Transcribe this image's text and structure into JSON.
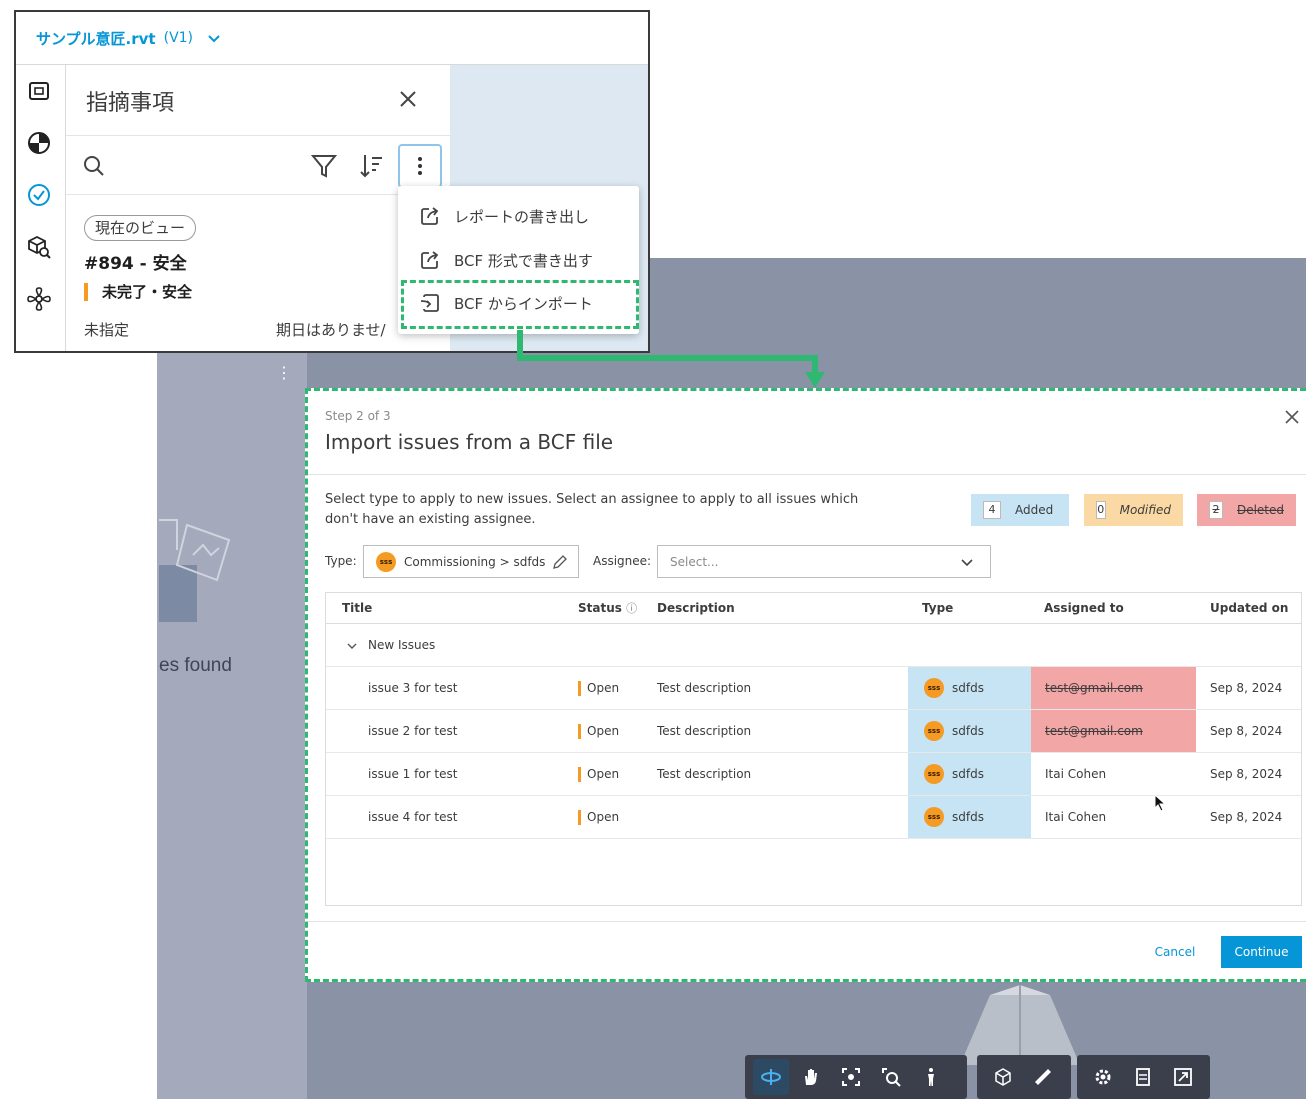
{
  "revit_panel": {
    "file_name": "サンプル意匠.rvt",
    "version": "(V1)",
    "issues_title": "指摘事項",
    "issue": {
      "chip": "現在のビュー",
      "id_title": "#894 - 安全",
      "status": "未完了・安全",
      "assignee": "未指定",
      "due": "期日はありませ/"
    },
    "menu": [
      {
        "label": "レポートの書き出し",
        "icon": "export-icon"
      },
      {
        "label": "BCF 形式で書き出す",
        "icon": "export-icon"
      },
      {
        "label": "BCF からインポート",
        "icon": "import-icon"
      }
    ]
  },
  "background": {
    "empty_text": "es found"
  },
  "dialog": {
    "step": "Step 2 of 3",
    "title": "Import issues from a BCF file",
    "instructions": "Select type to apply to new issues. Select an assignee to apply to all issues which don't have an existing assignee.",
    "legend": [
      {
        "count": "4",
        "label": "Added",
        "color": "#c6e4f4"
      },
      {
        "count": "0",
        "label": "Modified",
        "color": "#fbd9a4"
      },
      {
        "count": "2",
        "label": "Deleted",
        "color": "#f2a6a6"
      }
    ],
    "type_label": "Type:",
    "type_value": "Commissioning > sdfds",
    "badge": "sss",
    "assignee_label": "Assignee:",
    "assignee_placeholder": "Select...",
    "columns": [
      "Title",
      "Status",
      "Description",
      "Type",
      "Assigned to",
      "Updated on"
    ],
    "group": "New Issues",
    "rows": [
      {
        "title": "issue 3 for test",
        "status": "Open",
        "description": "Test description",
        "type": "sdfds",
        "assigned": "test@gmail.com",
        "assigned_deleted": true,
        "updated": "Sep 8, 2024"
      },
      {
        "title": "issue 2 for test",
        "status": "Open",
        "description": "Test description",
        "type": "sdfds",
        "assigned": "test@gmail.com",
        "assigned_deleted": true,
        "updated": "Sep 8, 2024"
      },
      {
        "title": "issue 1 for test",
        "status": "Open",
        "description": "Test description",
        "type": "sdfds",
        "assigned": "Itai Cohen",
        "assigned_deleted": false,
        "updated": "Sep 8, 2024"
      },
      {
        "title": "issue 4 for test",
        "status": "Open",
        "description": "",
        "type": "sdfds",
        "assigned": "Itai Cohen",
        "assigned_deleted": false,
        "updated": "Sep 8, 2024"
      }
    ],
    "cancel": "Cancel",
    "continue": "Continue"
  },
  "colors": {
    "accent": "#0696d7",
    "highlight": "#2eb872",
    "status_open": "#f59a23"
  }
}
